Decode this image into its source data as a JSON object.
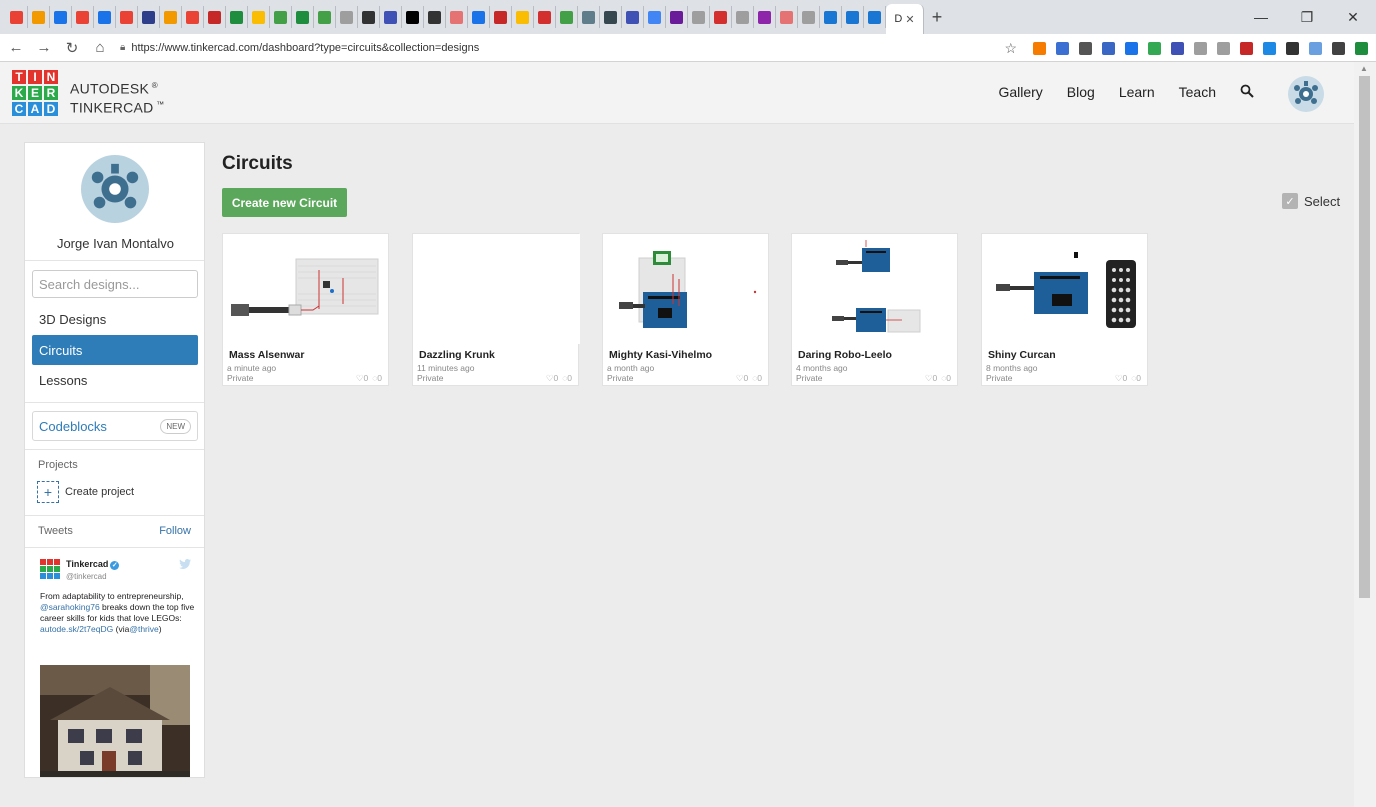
{
  "browser": {
    "url": "https://www.tinkercad.com/dashboard?type=circuits&collection=designs",
    "tab_colors": [
      "#e94235",
      "#f29900",
      "#1a73e8",
      "#ea4335",
      "#1a73e8",
      "#ea4335",
      "#2f3e8a",
      "#f29900",
      "#ea4335",
      "#c62828",
      "#1e8e3e",
      "#fbbc04",
      "#43a047",
      "#1e8e3e",
      "#43a047",
      "#9e9e9e",
      "#333333",
      "#3f51b5",
      "#000000",
      "#333333",
      "#e57373",
      "#1a73e8",
      "#c62828",
      "#fbbc04",
      "#d32f2f",
      "#43a047",
      "#607d8b",
      "#37474f",
      "#3f51b5",
      "#4285f4",
      "#6a1b9a",
      "#9e9e9e",
      "#d32f2f",
      "#9e9e9e",
      "#8e24aa",
      "#e57373",
      "#9e9e9e",
      "#1976d2",
      "#1976d2",
      "#1976d2"
    ],
    "active_tab_label": "D",
    "extension_colors": [
      "#f57c00",
      "#3b6fd1",
      "#555555",
      "#3a66c4",
      "#1a73e8",
      "#34a853",
      "#3f51b5",
      "#9e9e9e",
      "#9e9e9e",
      "#c62828",
      "#1e88e5",
      "#333333",
      "#6aa0e0",
      "#424242",
      "#1e8e3e"
    ]
  },
  "header": {
    "logo_letters": [
      "T",
      "I",
      "N",
      "K",
      "E",
      "R",
      "C",
      "A",
      "D"
    ],
    "logo_colors": [
      "#e2342c",
      "#e2342c",
      "#e2342c",
      "#2aaa4a",
      "#2aaa4a",
      "#2aaa4a",
      "#2a8fdb",
      "#2a8fdb",
      "#2a8fdb"
    ],
    "brand_line1": "AUTODESK",
    "brand_line2": "TINKERCAD",
    "nav": [
      "Gallery",
      "Blog",
      "Learn",
      "Teach"
    ]
  },
  "sidebar": {
    "username": "Jorge Ivan Montalvo",
    "search_placeholder": "Search designs...",
    "items": [
      {
        "label": "3D Designs",
        "active": false
      },
      {
        "label": "Circuits",
        "active": true
      },
      {
        "label": "Lessons",
        "active": false
      }
    ],
    "codeblocks_label": "Codeblocks",
    "codeblocks_badge": "NEW",
    "projects_title": "Projects",
    "create_project": "Create project",
    "tweets_title": "Tweets",
    "follow": "Follow",
    "tweet": {
      "name": "Tinkercad",
      "handle": "@tinkercad",
      "text_1": "From adaptability to entrepreneurship,",
      "mention": "@sarahoking76",
      "text_2": "breaks down the top five career skills for kids that love LEGOs:",
      "link": "autode.sk/2t7eqDG",
      "text_3": "(via",
      "via": "@thrive",
      "text_4": ")"
    }
  },
  "main": {
    "title": "Circuits",
    "create_button": "Create new Circuit",
    "select_label": "Select",
    "designs": [
      {
        "title": "Mass Alsenwar",
        "time": "a minute ago",
        "privacy": "Private",
        "likes": "0",
        "comments": "0"
      },
      {
        "title": "Dazzling Krunk",
        "time": "11 minutes ago",
        "privacy": "Private",
        "likes": "0",
        "comments": "0"
      },
      {
        "title": "Mighty Kasi-Vihelmo",
        "time": "a month ago",
        "privacy": "Private",
        "likes": "0",
        "comments": "0"
      },
      {
        "title": "Daring Robo-Leelo",
        "time": "4 months ago",
        "privacy": "Private",
        "likes": "0",
        "comments": "0"
      },
      {
        "title": "Shiny Curcan",
        "time": "8 months ago",
        "privacy": "Private",
        "likes": "0",
        "comments": "0"
      }
    ]
  }
}
